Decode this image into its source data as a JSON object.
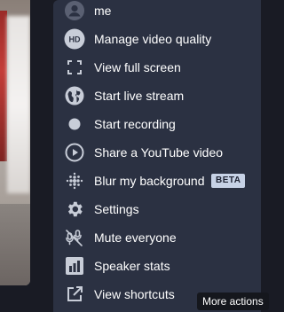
{
  "menu": {
    "items": [
      {
        "label": "me",
        "icon": "avatar-icon"
      },
      {
        "label": "Manage video quality",
        "icon": "hd-icon"
      },
      {
        "label": "View full screen",
        "icon": "fullscreen-icon"
      },
      {
        "label": "Start live stream",
        "icon": "globe-icon"
      },
      {
        "label": "Start recording",
        "icon": "record-icon"
      },
      {
        "label": "Share a YouTube video",
        "icon": "play-circle-icon"
      },
      {
        "label": "Blur my background",
        "icon": "blur-icon",
        "badge": "BETA"
      },
      {
        "label": "Settings",
        "icon": "gear-icon"
      },
      {
        "label": "Mute everyone",
        "icon": "mute-everyone-icon"
      },
      {
        "label": "Speaker stats",
        "icon": "stats-icon"
      },
      {
        "label": "View shortcuts",
        "icon": "open-external-icon"
      }
    ]
  },
  "tooltip": {
    "text": "More actions"
  },
  "colors": {
    "panel": "#2b3142",
    "text": "#ffffff",
    "icon": "#c8cdd8",
    "badge": "#c7d2e6"
  }
}
